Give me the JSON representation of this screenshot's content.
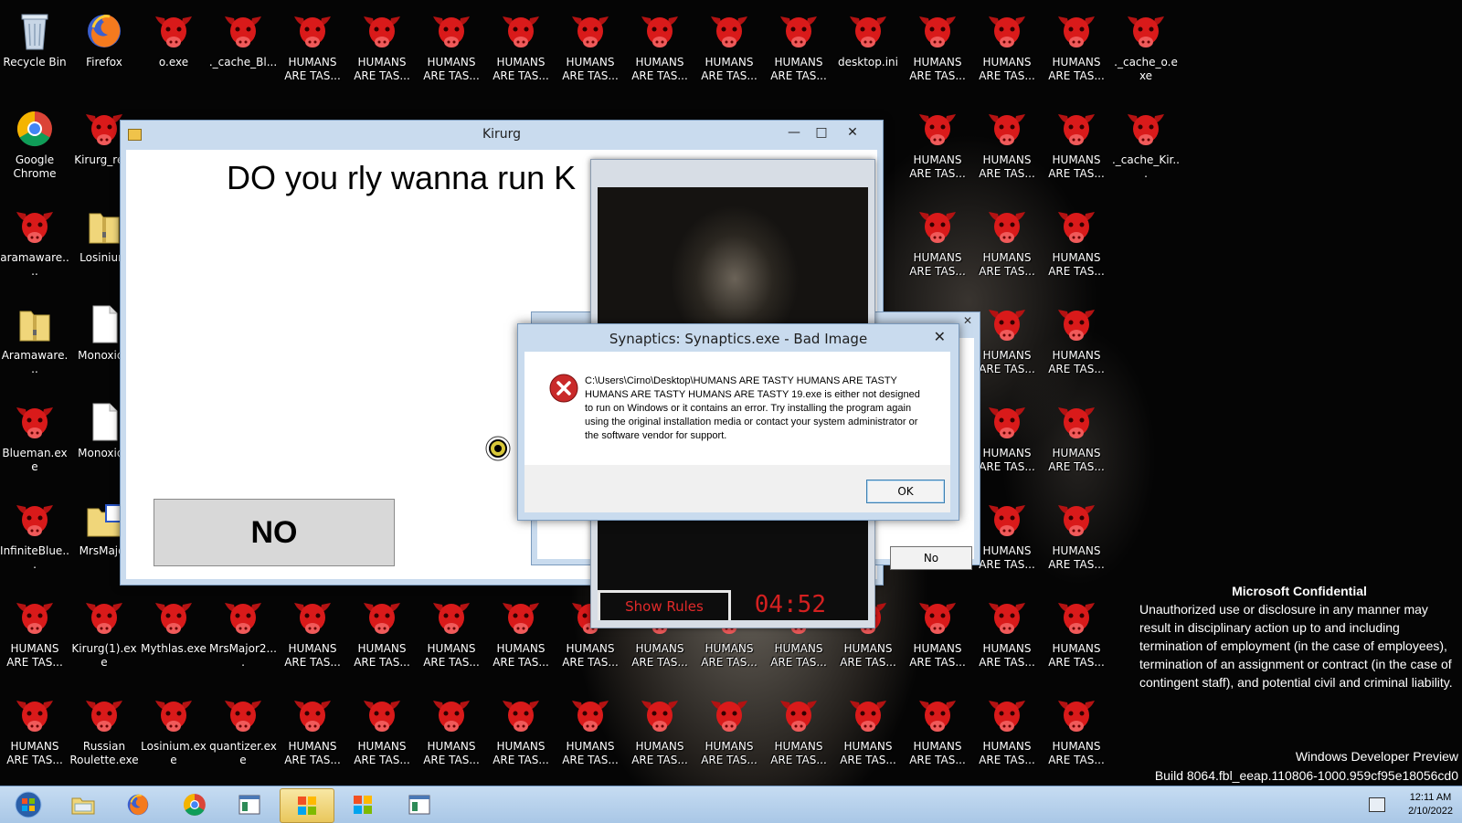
{
  "desktop": {
    "icons": [
      {
        "label": "Recycle Bin",
        "type": "recycle"
      },
      {
        "label": "Firefox",
        "type": "firefox"
      },
      {
        "label": "o.exe",
        "type": "bull"
      },
      {
        "label": "._cache_Bl...",
        "type": "bull"
      },
      {
        "label": "HUMANS ARE TAS...",
        "type": "bull"
      },
      {
        "label": "HUMANS ARE TAS...",
        "type": "bull"
      },
      {
        "label": "HUMANS ARE TAS...",
        "type": "bull"
      },
      {
        "label": "HUMANS ARE TAS...",
        "type": "bull"
      },
      {
        "label": "HUMANS ARE TAS...",
        "type": "bull"
      },
      {
        "label": "HUMANS ARE TAS...",
        "type": "bull"
      },
      {
        "label": "HUMANS ARE TAS...",
        "type": "bull"
      },
      {
        "label": "HUMANS ARE TAS...",
        "type": "bull"
      },
      {
        "label": "desktop.ini",
        "type": "bull"
      },
      {
        "label": "HUMANS ARE TAS...",
        "type": "bull"
      },
      {
        "label": "HUMANS ARE TAS...",
        "type": "bull"
      },
      {
        "label": "HUMANS ARE TAS...",
        "type": "bull"
      },
      {
        "label": "._cache_o.exe",
        "type": "bull"
      },
      {
        "label": "Google Chrome",
        "type": "chrome"
      },
      {
        "label": "Kirurg_re...",
        "type": "bull"
      },
      {
        "label": "HUMANS ARE TAS...",
        "type": "bull"
      },
      {
        "label": "HUMANS ARE TAS...",
        "type": "bull"
      },
      {
        "label": "HUMANS ARE TAS...",
        "type": "bull"
      },
      {
        "label": "._cache_Kir...",
        "type": "bull"
      },
      {
        "label": "aramaware....",
        "type": "bull"
      },
      {
        "label": "Losinium",
        "type": "zip"
      },
      {
        "label": "HUMANS ARE TAS...",
        "type": "bull"
      },
      {
        "label": "HUMANS ARE TAS...",
        "type": "bull"
      },
      {
        "label": "HUMANS ARE TAS...",
        "type": "bull"
      },
      {
        "label": "Aramaware...",
        "type": "zip"
      },
      {
        "label": "Monoxide",
        "type": "file"
      },
      {
        "label": "HUMANS ARE TAS...",
        "type": "bull"
      },
      {
        "label": "HUMANS ARE TAS...",
        "type": "bull"
      },
      {
        "label": "Blueman.exe",
        "type": "bull"
      },
      {
        "label": "Monoxide",
        "type": "file"
      },
      {
        "label": "HUMANS ARE TAS...",
        "type": "bull"
      },
      {
        "label": "HUMANS ARE TAS...",
        "type": "bull"
      },
      {
        "label": "InfiniteBlue...",
        "type": "bull"
      },
      {
        "label": "MrsMajor",
        "type": "folder"
      },
      {
        "label": "HUMANS ARE TAS...",
        "type": "bull"
      },
      {
        "label": "HUMANS ARE TAS...",
        "type": "bull"
      },
      {
        "label": "HUMANS ARE TAS...",
        "type": "bull"
      },
      {
        "label": "Kirurg(1).exe",
        "type": "bull"
      },
      {
        "label": "Mythlas.exe",
        "type": "bull"
      },
      {
        "label": "MrsMajor2....",
        "type": "bull"
      },
      {
        "label": "HUMANS ARE TAS...",
        "type": "bull"
      },
      {
        "label": "HUMANS ARE TAS...",
        "type": "bull"
      },
      {
        "label": "HUMANS ARE TAS...",
        "type": "bull"
      },
      {
        "label": "HUMANS ARE TAS...",
        "type": "bull"
      },
      {
        "label": "HUMANS ARE TAS...",
        "type": "bull"
      },
      {
        "label": "HUMANS ARE TAS...",
        "type": "bull"
      },
      {
        "label": "HUMANS ARE TAS...",
        "type": "bull"
      },
      {
        "label": "HUMANS ARE TAS...",
        "type": "bull"
      },
      {
        "label": "HUMANS ARE TAS...",
        "type": "bull"
      },
      {
        "label": "HUMANS ARE TAS...",
        "type": "bull"
      },
      {
        "label": "HUMANS ARE TAS...",
        "type": "bull"
      },
      {
        "label": "HUMANS ARE TAS...",
        "type": "bull"
      },
      {
        "label": "HUMANS ARE TAS...",
        "type": "bull"
      },
      {
        "label": "Russian Roulette.exe",
        "type": "bull"
      },
      {
        "label": "Losinium.exe",
        "type": "bull"
      },
      {
        "label": "quantizer.exe",
        "type": "bull"
      },
      {
        "label": "HUMANS ARE TAS...",
        "type": "bull"
      },
      {
        "label": "HUMANS ARE TAS...",
        "type": "bull"
      },
      {
        "label": "HUMANS ARE TAS...",
        "type": "bull"
      },
      {
        "label": "HUMANS ARE TAS...",
        "type": "bull"
      },
      {
        "label": "HUMANS ARE TAS...",
        "type": "bull"
      },
      {
        "label": "HUMANS ARE TAS...",
        "type": "bull"
      },
      {
        "label": "HUMANS ARE TAS...",
        "type": "bull"
      },
      {
        "label": "HUMANS ARE TAS...",
        "type": "bull"
      },
      {
        "label": "HUMANS ARE TAS...",
        "type": "bull"
      },
      {
        "label": "HUMANS ARE TAS...",
        "type": "bull"
      },
      {
        "label": "HUMANS ARE TAS...",
        "type": "bull"
      },
      {
        "label": "HUMANS ARE TAS...",
        "type": "bull"
      },
      {
        "label": "HUMANS ARE TAS...",
        "type": "bull"
      }
    ]
  },
  "kirurg_window": {
    "title": "Kirurg",
    "question": "DO you rly wanna run K",
    "no_button": "NO"
  },
  "back_dialog": {
    "no_button": "No"
  },
  "rules_panel": {
    "show_rules": "Show Rules",
    "timer": "04:52"
  },
  "error_dialog": {
    "title": "Synaptics: Synaptics.exe - Bad Image",
    "message": "C:\\Users\\Cirno\\Desktop\\HUMANS ARE TASTY HUMANS ARE TASTY HUMANS ARE TASTY HUMANS ARE TASTY 19.exe is either not designed to run on Windows or it contains an error. Try installing the program again using the original installation media or contact your system administrator or the software vendor for support.",
    "ok_button": "OK"
  },
  "confidential": {
    "heading": "Microsoft Confidential",
    "body": "Unauthorized use or disclosure in any manner may result in disciplinary action up to and including termination of employment (in the case of employees), termination of an assignment or contract (in the case of contingent staff), and potential civil and criminal liability."
  },
  "watermark": {
    "line1": "Windows Developer Preview",
    "line2": "Build 8064.fbl_eeap.110806-1000.959cf95e18056cd0"
  },
  "taskbar": {
    "items": [
      "start-orb-icon",
      "file-explorer-icon",
      "firefox-icon",
      "chrome-icon",
      "window-app-icon",
      "flag-app-icon",
      "flag-app-icon",
      "window-app-icon"
    ],
    "active_index": 5,
    "time": "12:11 AM",
    "date": "2/10/2022"
  },
  "colors": {
    "bull_red": "#d91a1a",
    "window_frame": "#c9dbee",
    "taskbar": "#b7d1ec",
    "timer_red": "#d42020"
  }
}
